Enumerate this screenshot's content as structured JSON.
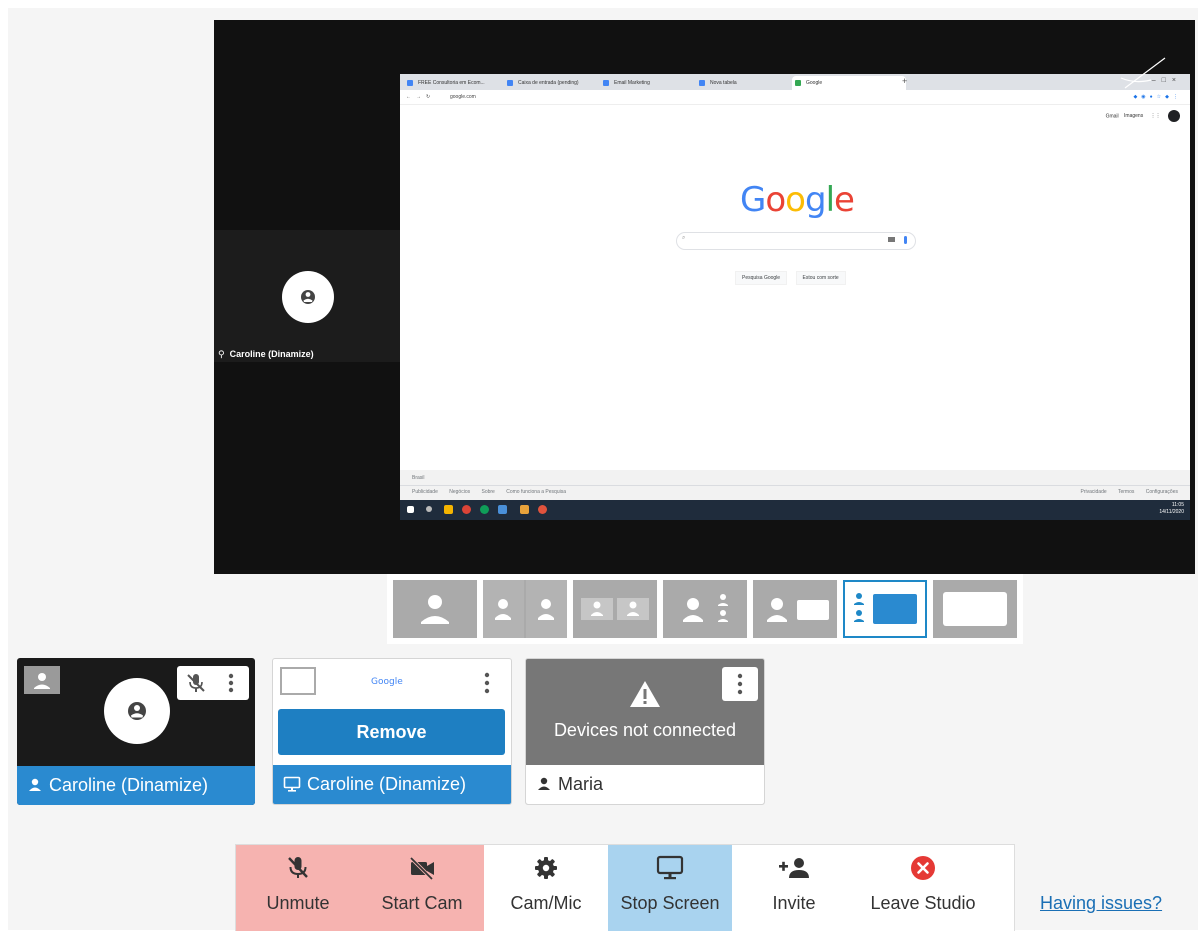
{
  "stage": {
    "camera_label": "Caroline (Dinamize)"
  },
  "browser": {
    "tabs": [
      "FREE Consultoria em Ecom...",
      "Caixa de entrada (pending)",
      "Email Marketing",
      "Nova tabela",
      "Google"
    ],
    "url": "google.com",
    "google_logo": "Google",
    "top_links": [
      "Gmail",
      "Imagens"
    ],
    "search_buttons": [
      "Pesquisa Google",
      "Estou com sorte"
    ],
    "country": "Brasil",
    "footer_left": [
      "Publicidade",
      "Negócios",
      "Sobre",
      "Como funciona a Pesquisa"
    ],
    "footer_right": [
      "Privacidade",
      "Termos",
      "Configurações"
    ],
    "clock_time": "11:05",
    "clock_date": "14/11/2020"
  },
  "tiles": [
    {
      "name": "Caroline (Dinamize)",
      "type": "camera"
    },
    {
      "name": "Caroline (Dinamize)",
      "type": "screen",
      "button": "Remove",
      "preview": "Google"
    },
    {
      "name": "Maria",
      "type": "camera",
      "status": "Devices not connected"
    }
  ],
  "controls": {
    "unmute": "Unmute",
    "start_cam": "Start Cam",
    "cam_mic": "Cam/Mic",
    "stop_screen": "Stop Screen",
    "invite": "Invite",
    "leave": "Leave Studio"
  },
  "help_link": "Having issues?",
  "colors": {
    "accent": "#2a8ad0",
    "muted_button": "#f6b3b0",
    "active_button": "#a9d3ef",
    "leave_icon": "#e53935"
  }
}
